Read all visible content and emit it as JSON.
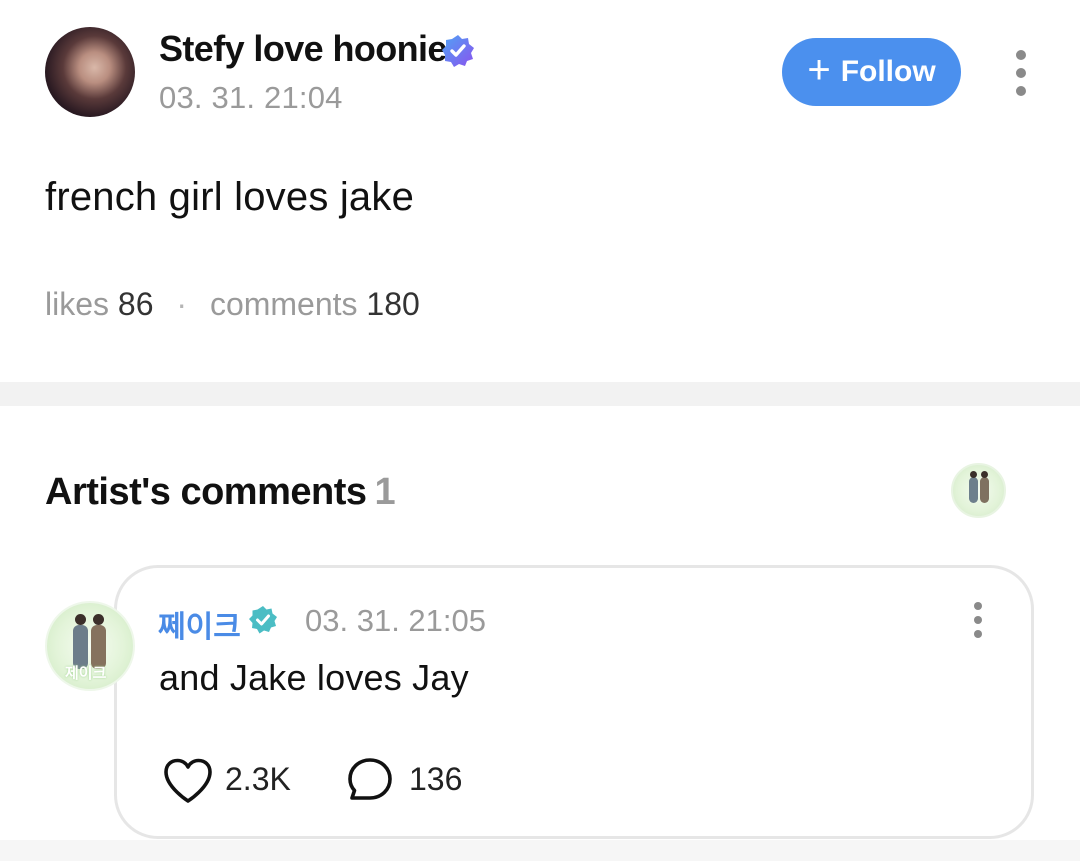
{
  "post": {
    "author_name": "Stefy love hoonie",
    "timestamp": "03. 31. 21:04",
    "follow_label": "Follow",
    "body": "french girl loves jake",
    "stats": {
      "likes_label": "likes",
      "likes_count": "86",
      "separator": "·",
      "comments_label": "comments",
      "comments_count": "180"
    }
  },
  "artist_comments": {
    "title": "Artist's comments",
    "count": "1",
    "comment": {
      "author": "쩨이크",
      "timestamp": "03. 31. 21:05",
      "text": "and Jake loves Jay",
      "avatar_tag": "제이크",
      "likes": "2.3K",
      "replies": "136"
    }
  },
  "icons": {
    "author_badge": "verified-heart-badge-icon",
    "artist_badge": "verified-check-badge-icon",
    "follow": "plus-icon",
    "menu": "kebab-menu-icon",
    "like": "heart-outline-icon",
    "reply": "speech-bubble-icon"
  },
  "colors": {
    "accent": "#4b90ee",
    "artist_name": "#4a8be6",
    "artist_badge": "#4bbdc4",
    "author_badge": "#7a5cf0",
    "muted_text": "#9a9a9a"
  }
}
